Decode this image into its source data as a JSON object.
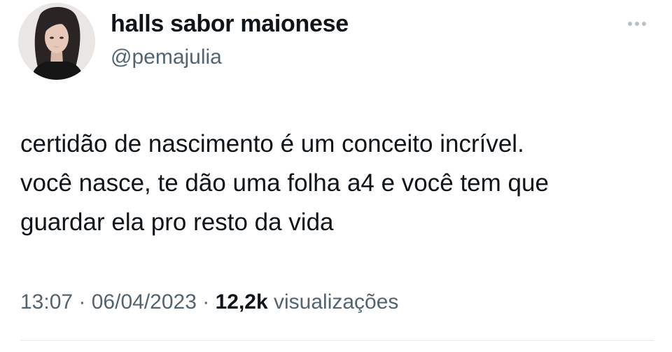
{
  "author": {
    "display_name": "halls sabor maionese",
    "handle": "@pemajulia",
    "avatar_icon": "profile-photo"
  },
  "more_icon": "ellipsis-icon",
  "tweet": {
    "lines": [
      "certidão de nascimento é um conceito incrível.",
      "você nasce, te dão uma folha a4 e você tem que",
      "guardar ela pro resto da vida"
    ]
  },
  "meta": {
    "time": "13:07",
    "separator": " · ",
    "date": "06/04/2023",
    "views_count": "12,2k",
    "views_label": "visualizações"
  },
  "colors": {
    "text": "#0f1419",
    "secondary": "#536471",
    "divider": "#e3e7ea"
  }
}
